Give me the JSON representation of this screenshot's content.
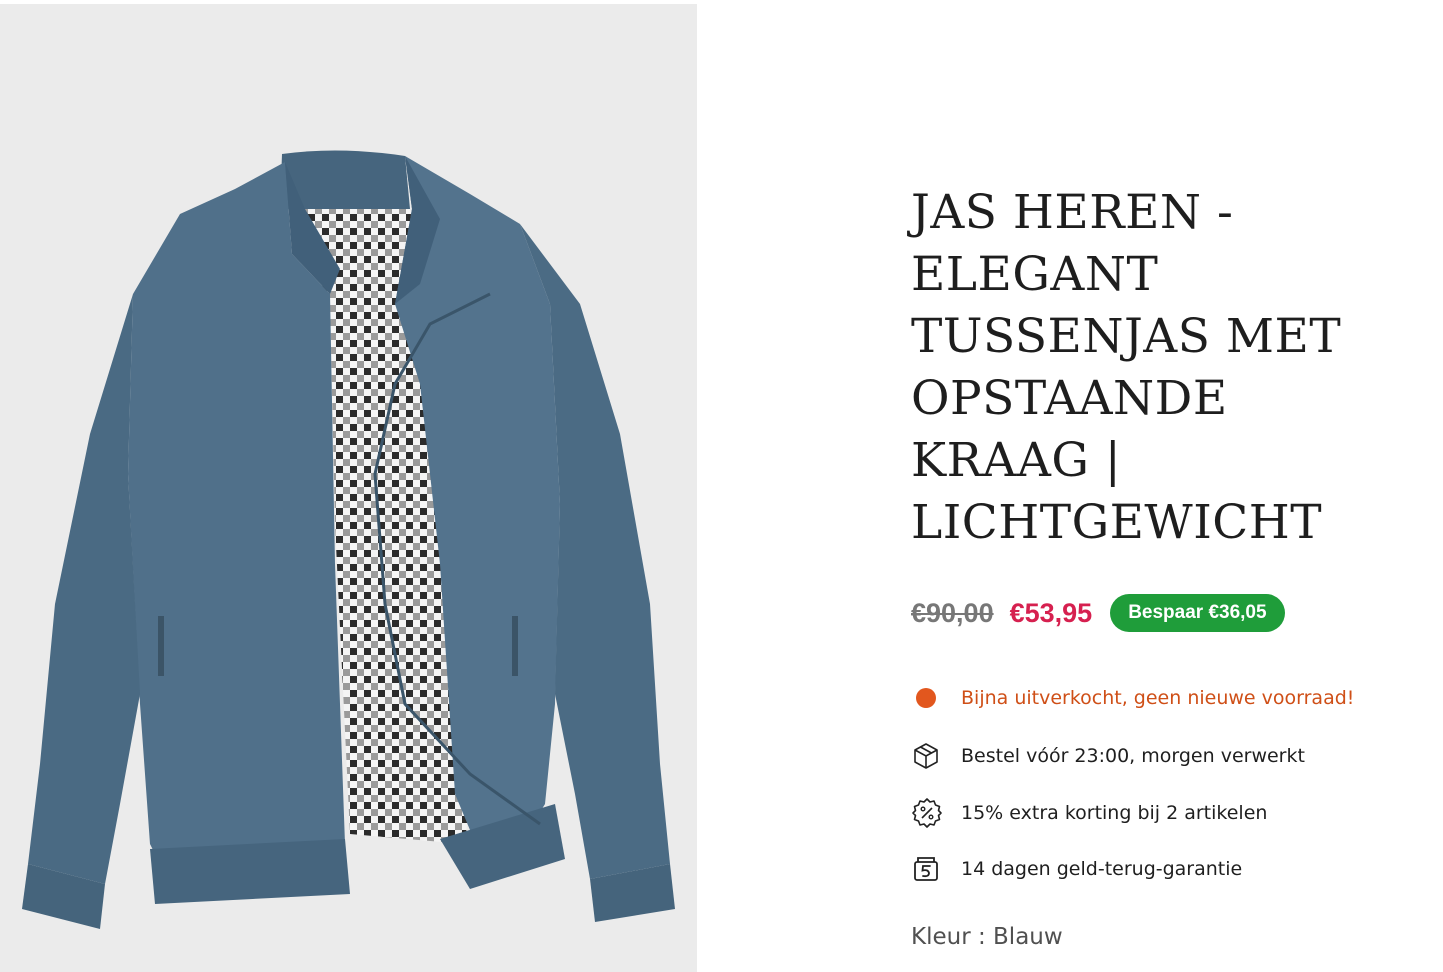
{
  "product": {
    "title": "JAS HEREN - ELEGANT TUSSENJAS MET OPSTAANDE KRAAG | LICHTGEWICHT",
    "image_alt": "Blauwe heren tussenjas met opstaande kraag en geruite voering"
  },
  "pricing": {
    "old_price": "€90,00",
    "sale_price": "€53,95",
    "save_badge": "Bespaar €36,05"
  },
  "features": [
    {
      "icon": "status-dot-icon",
      "text": "Bijna uitverkocht, geen nieuwe voorraad!",
      "color": "#cf4f17"
    },
    {
      "icon": "package-icon",
      "text": "Bestel vóór 23:00, morgen verwerkt"
    },
    {
      "icon": "discount-badge-icon",
      "text": "15% extra korting bij 2 artikelen"
    },
    {
      "icon": "money-back-icon",
      "text": "14 dagen geld-terug-garantie"
    }
  ],
  "variant": {
    "color_label": "Kleur : Blauw"
  },
  "colors": {
    "gallery_bg": "#ebebeb",
    "sale_price": "#d6204f",
    "badge_bg": "#1f9d3a",
    "stock_warning": "#e2571e",
    "jacket": "#4f6f88"
  }
}
